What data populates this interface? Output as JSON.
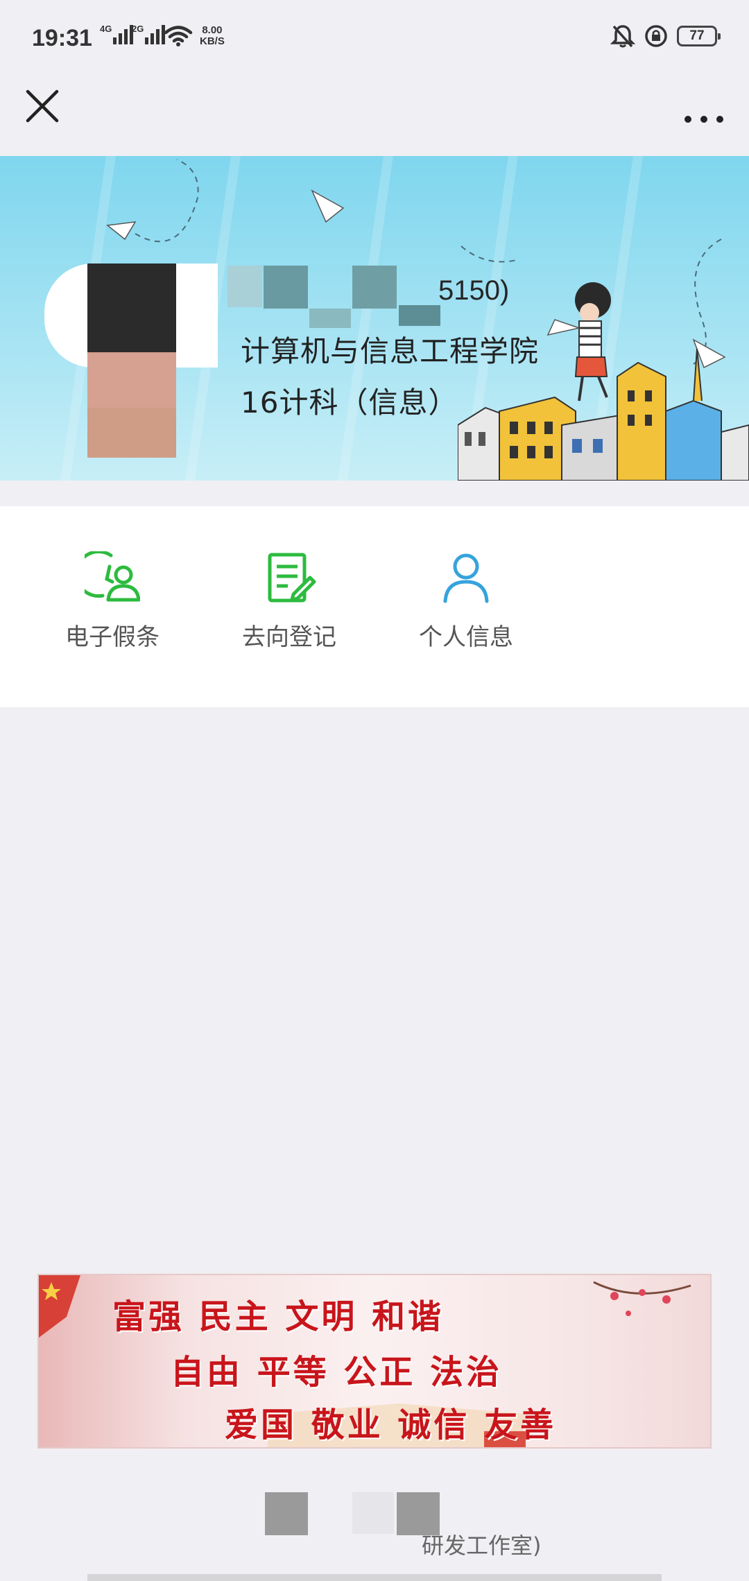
{
  "status_bar": {
    "time": "19:31",
    "signal_1_label": "4G",
    "signal_2_label": "2G",
    "speed_value": "8.00",
    "speed_unit": "KB/S",
    "battery_level": "77",
    "icons": [
      "signal-icon",
      "wifi-icon",
      "bell-muted-icon",
      "rotation-lock-icon",
      "battery-icon"
    ]
  },
  "nav": {
    "close_icon": "close-icon",
    "more_icon": "more-icon"
  },
  "profile": {
    "id_partial": "5150)",
    "college": "计算机与信息工程学院",
    "class": "16计科（信息）"
  },
  "actions": [
    {
      "label": "电子假条",
      "icon": "leave-note-icon",
      "color": "#2dbb3f"
    },
    {
      "label": "去向登记",
      "icon": "register-icon",
      "color": "#2dbb3f"
    },
    {
      "label": "个人信息",
      "icon": "person-icon",
      "color": "#36a3dc"
    }
  ],
  "slogan": {
    "row1": "富强 民主 文明 和谐",
    "row2": "自由 平等 公正 法治",
    "row3": "爱国 敬业 诚信 友善"
  },
  "footer": {
    "text": "研发工作室)"
  }
}
